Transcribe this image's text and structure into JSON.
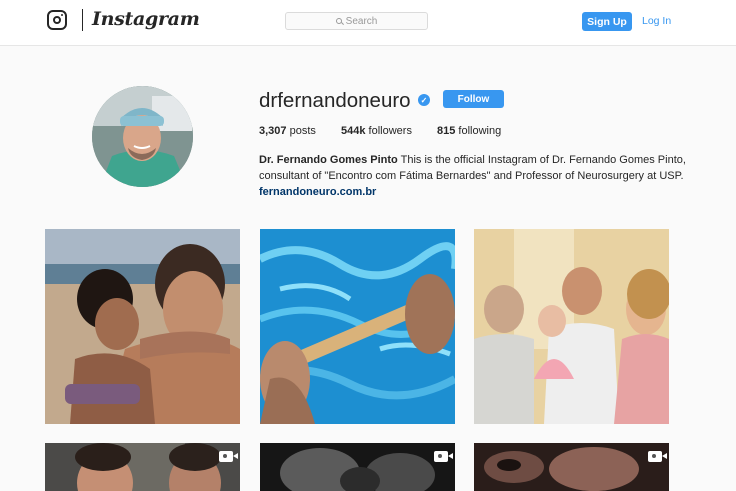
{
  "header": {
    "wordmark": "Instagram",
    "search_placeholder": "Search",
    "signup_label": "Sign Up",
    "login_label": "Log In"
  },
  "profile": {
    "username": "drfernandoneuro",
    "verified_mark": "✓",
    "follow_label": "Follow",
    "stats": [
      {
        "value": "3,307",
        "label": "posts"
      },
      {
        "value": "544k",
        "label": "followers"
      },
      {
        "value": "815",
        "label": "following"
      }
    ],
    "full_name": "Dr. Fernando Gomes Pinto",
    "bio": "This is the official Instagram of Dr. Fernando Gomes Pinto, consultant of \"Encontro com Fátima Bernardes\" and Professor of Neurosurgery at USP.",
    "website": "fernandoneuro.com.br"
  },
  "posts": [
    {
      "kind": "photo",
      "icon": "none"
    },
    {
      "kind": "photo",
      "icon": "none"
    },
    {
      "kind": "photo",
      "icon": "none"
    },
    {
      "kind": "video",
      "icon": "video-icon"
    },
    {
      "kind": "video",
      "icon": "video-icon"
    },
    {
      "kind": "video",
      "icon": "video-icon"
    }
  ],
  "colors": {
    "accent": "#3897f0",
    "link": "#003569",
    "background": "#fafafa"
  }
}
